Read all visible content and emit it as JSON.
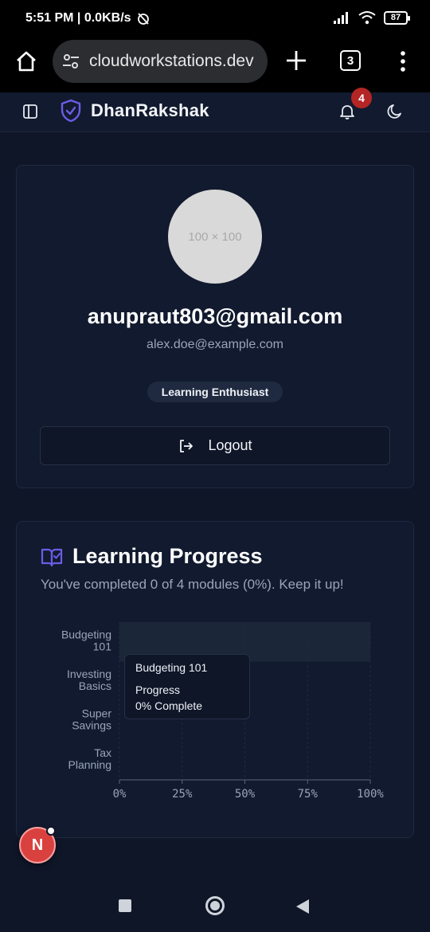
{
  "status_bar": {
    "time_info": "5:51 PM | 0.0KB/s",
    "battery": "87"
  },
  "browser": {
    "url": "cloudworkstations.dev",
    "tab_count": "3"
  },
  "app_header": {
    "brand": "DhanRakshak",
    "notification_count": "4"
  },
  "profile": {
    "avatar_placeholder": "100 × 100",
    "display_name": "anupraut803@gmail.com",
    "email": "alex.doe@example.com",
    "role_badge": "Learning Enthusiast",
    "logout_label": "Logout"
  },
  "learning_progress": {
    "title": "Learning Progress",
    "description": "You've completed 0 of 4 modules (0%). Keep it up!",
    "tooltip": {
      "title": "Budgeting 101",
      "label": "Progress",
      "value": "0% Complete"
    }
  },
  "chart_data": {
    "type": "bar",
    "orientation": "horizontal",
    "categories": [
      "Budgeting 101",
      "Investing Basics",
      "Super Savings",
      "Tax Planning"
    ],
    "values": [
      0,
      0,
      0,
      0
    ],
    "x_ticks": [
      "0%",
      "25%",
      "50%",
      "75%",
      "100%"
    ],
    "xlim": [
      0,
      100
    ],
    "highlighted_category": "Budgeting 101",
    "grid": true
  },
  "fab": {
    "label": "N"
  },
  "colors": {
    "accent": "#6c5ce7",
    "background": "#0f1628",
    "card": "#111a2e",
    "badge": "#b42525"
  }
}
